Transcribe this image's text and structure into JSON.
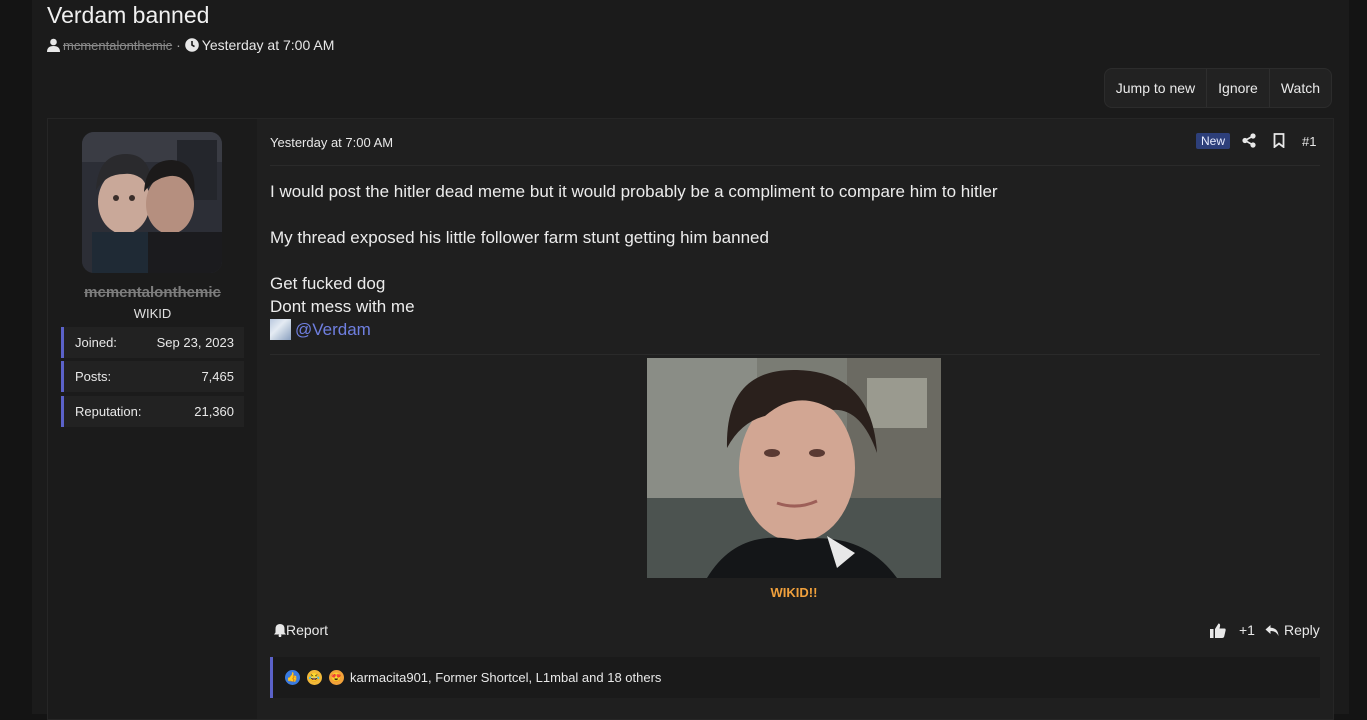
{
  "thread": {
    "title": "Verdam banned",
    "author": "mcmentalonthemic",
    "separator": "·",
    "time": "Yesterday at 7:00 AM"
  },
  "actions": {
    "jump_to_new": "Jump to new",
    "ignore": "Ignore",
    "watch": "Watch"
  },
  "user": {
    "name": "mcmentalonthemic",
    "title": "WIKID",
    "stats": [
      {
        "label": "Joined:",
        "value": "Sep 23, 2023"
      },
      {
        "label": "Posts:",
        "value": "7,465"
      },
      {
        "label": "Reputation:",
        "value": "21,360"
      }
    ]
  },
  "post": {
    "date": "Yesterday at 7:00 AM",
    "badge": "New",
    "number": "#1",
    "lines": [
      "I would post the hitler dead meme but it would probably be a compliment to compare him to hitler",
      "My thread exposed his little follower farm stunt getting him banned",
      "Get fucked dog",
      "Dont mess with me"
    ],
    "mention": "@Verdam",
    "caption": "WIKID!!",
    "report": "Report",
    "likes": "+1",
    "reply": "Reply",
    "reactions_text": "karmacita901, Former Shortcel, L1mbal and 18 others"
  },
  "colors": {
    "accent": "#5b62c9",
    "mention": "#6f7fe0",
    "caption": "#f0a03c",
    "badge": "#2d3f7a"
  }
}
